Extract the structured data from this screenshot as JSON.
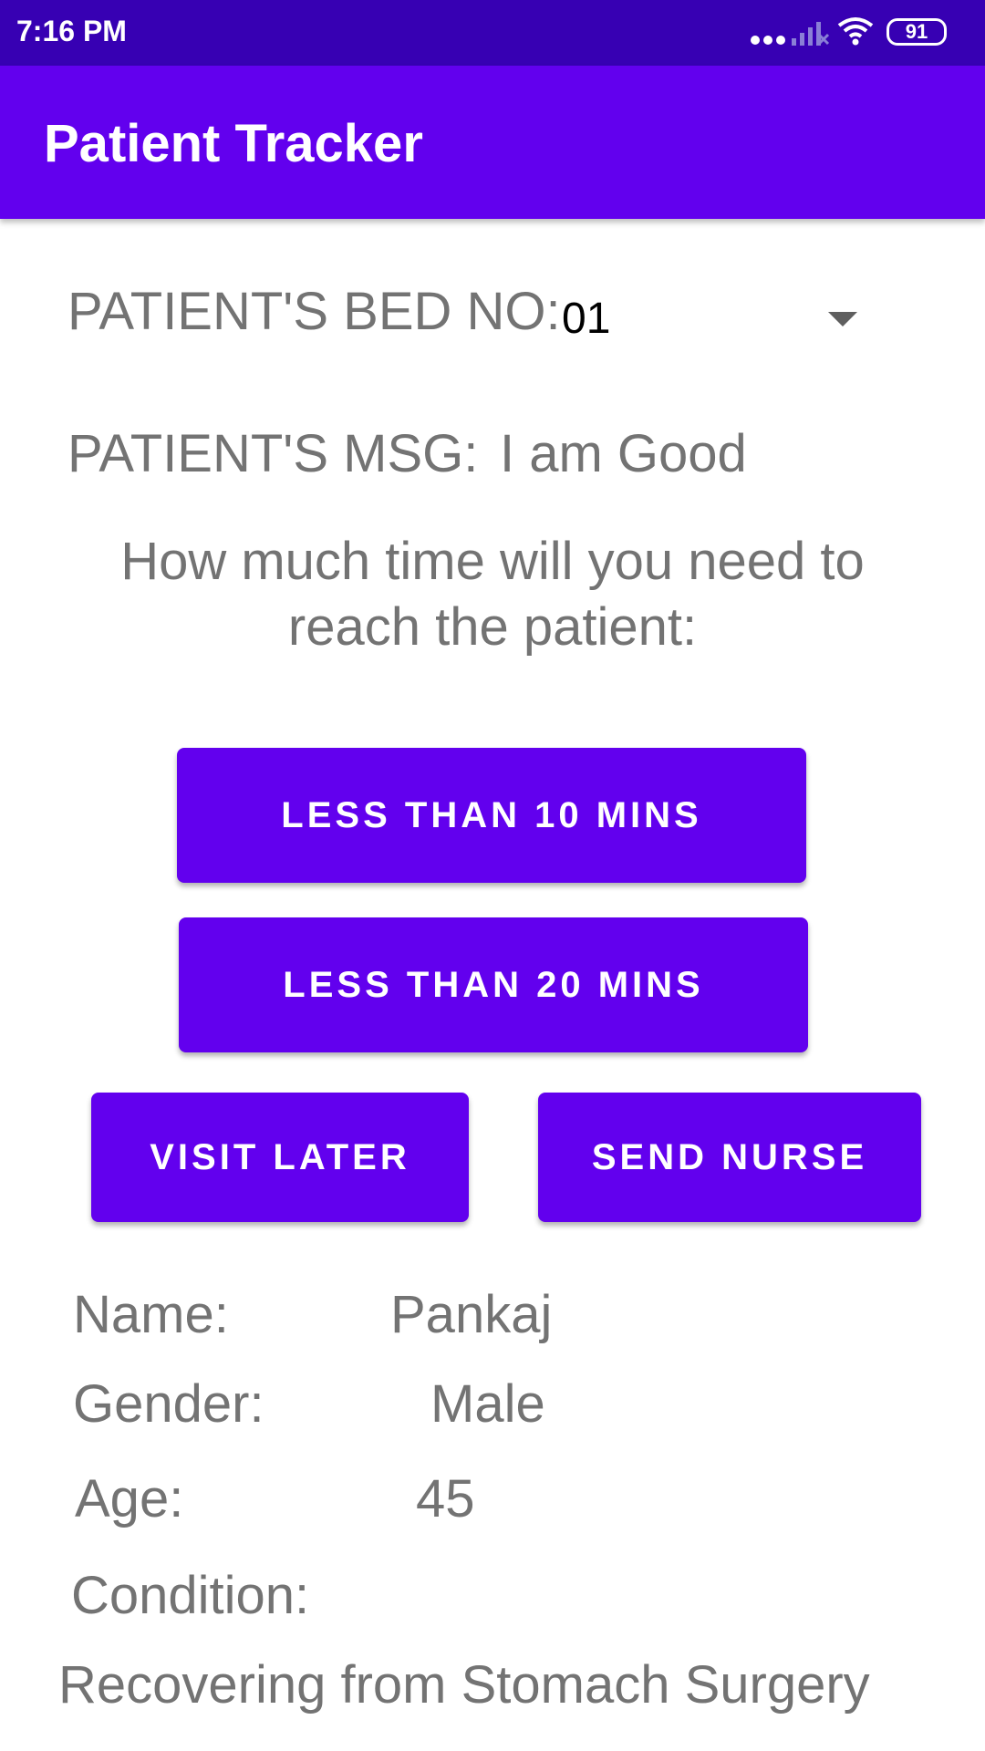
{
  "status_bar": {
    "time": "7:16 PM",
    "battery_level": "91",
    "icons": [
      "more-dots-icon",
      "signal-icon",
      "wifi-icon",
      "battery-icon"
    ]
  },
  "app_bar": {
    "title": "Patient Tracker"
  },
  "bed": {
    "label": "PATIENT'S BED NO:",
    "selected_value": "01"
  },
  "message": {
    "label": "PATIENT'S MSG:",
    "value": "I am Good"
  },
  "question": "How much time will you need to reach the patient:",
  "buttons": {
    "less_than_10": "LESS THAN 10 MINS",
    "less_than_20": "LESS THAN 20 MINS",
    "visit_later": "VISIT LATER",
    "send_nurse": "SEND NURSE"
  },
  "patient": {
    "name_label": "Name:",
    "name_value": "Pankaj",
    "gender_label": "Gender:",
    "gender_value": "Male",
    "age_label": "Age:",
    "age_value": "45",
    "condition_label": "Condition:",
    "condition_value": "Recovering from Stomach Surgery"
  },
  "colors": {
    "primary": "#6200ee",
    "primary_dark": "#3700b3",
    "text_gray": "#737373"
  }
}
